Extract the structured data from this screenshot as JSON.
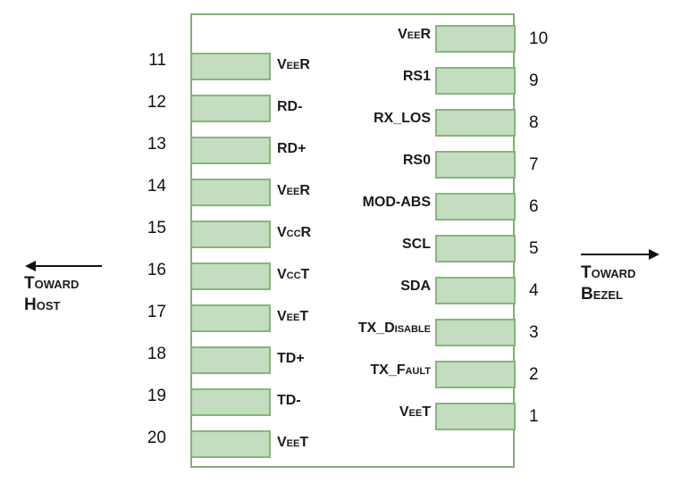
{
  "left_pins": [
    {
      "num": "11",
      "label": "VeeR"
    },
    {
      "num": "12",
      "label": "RD-"
    },
    {
      "num": "13",
      "label": "RD+"
    },
    {
      "num": "14",
      "label": "VeeR"
    },
    {
      "num": "15",
      "label": "VccR"
    },
    {
      "num": "16",
      "label": "VccT"
    },
    {
      "num": "17",
      "label": "VeeT"
    },
    {
      "num": "18",
      "label": "TD+"
    },
    {
      "num": "19",
      "label": "TD-"
    },
    {
      "num": "20",
      "label": "VeeT"
    }
  ],
  "right_pins": [
    {
      "num": "10",
      "label": "VeeR"
    },
    {
      "num": "9",
      "label": "RS1"
    },
    {
      "num": "8",
      "label": "RX_LOS"
    },
    {
      "num": "7",
      "label": "RS0"
    },
    {
      "num": "6",
      "label": "MOD-ABS"
    },
    {
      "num": "5",
      "label": "SCL"
    },
    {
      "num": "4",
      "label": "SDA"
    },
    {
      "num": "3",
      "label": "TX_Disable"
    },
    {
      "num": "2",
      "label": "TX_Fault"
    },
    {
      "num": "1",
      "label": "VeeT"
    }
  ],
  "direction_left": {
    "line1": "Toward",
    "line2": "Host"
  },
  "direction_right": {
    "line1": "Toward",
    "line2": "Bezel"
  },
  "colors": {
    "pad_fill": "#c4dcc0",
    "outline": "#7fb072"
  }
}
